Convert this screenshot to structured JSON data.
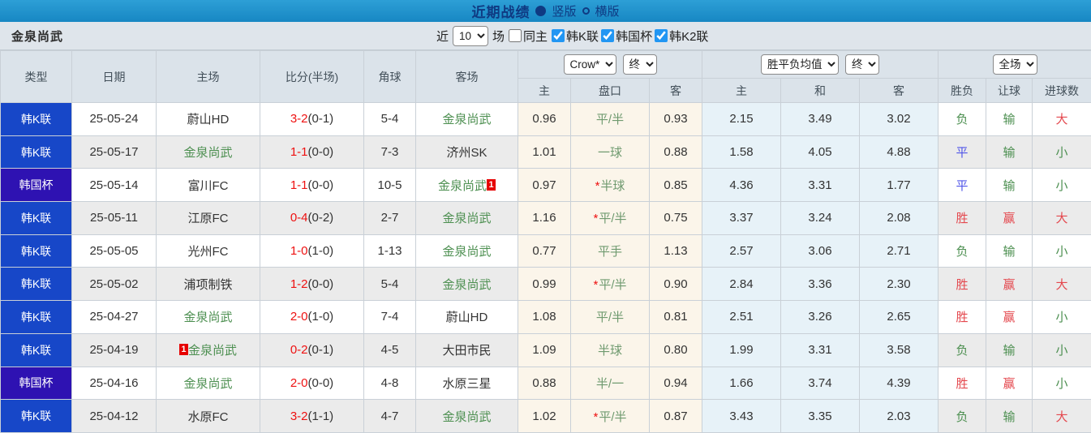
{
  "title_bar": {
    "title": "近期战绩",
    "radio_vertical": "竖版",
    "radio_horizontal": "横版",
    "vertical_selected": true
  },
  "filter_bar": {
    "team_name": "金泉尚武",
    "near_label": "近",
    "match_count": "10",
    "games_label": "场",
    "same_home_label": "同主",
    "same_home_checked": false,
    "league_filters": [
      {
        "label": "韩K联",
        "checked": true
      },
      {
        "label": "韩国杯",
        "checked": true
      },
      {
        "label": "韩K2联",
        "checked": true
      }
    ]
  },
  "table": {
    "cup_label": "韩国杯",
    "headers": {
      "type": "类型",
      "date": "日期",
      "home": "主场",
      "score": "比分(半场)",
      "corner": "角球",
      "away": "客场"
    },
    "odds_group": {
      "bookmaker": "Crow*",
      "period": "终",
      "sub": [
        "主",
        "盘口",
        "客"
      ]
    },
    "mean_group": {
      "label": "胜平负均值",
      "period": "终",
      "sub": [
        "主",
        "和",
        "客"
      ]
    },
    "result_group": {
      "label": "全场",
      "sub": [
        "胜负",
        "让球",
        "进球数"
      ]
    },
    "rows": [
      {
        "type": "韩K联",
        "date": "25-05-24",
        "home": "蔚山HD",
        "home_badge": null,
        "score": "3-2",
        "half": "(0-1)",
        "corner": "5-4",
        "away": "金泉尚武",
        "away_badge": null,
        "odds_home": "0.96",
        "handicap": "平/半",
        "handicap_star": false,
        "odds_away": "0.93",
        "avg_home": "2.15",
        "avg_draw": "3.49",
        "avg_away": "3.02",
        "result_wdl": "负",
        "result_handicap": "输",
        "result_goals": "大"
      },
      {
        "type": "韩K联",
        "date": "25-05-17",
        "home": "金泉尚武",
        "home_badge": null,
        "score": "1-1",
        "half": "(0-0)",
        "corner": "7-3",
        "away": "济州SK",
        "away_badge": null,
        "odds_home": "1.01",
        "handicap": "一球",
        "handicap_star": false,
        "odds_away": "0.88",
        "avg_home": "1.58",
        "avg_draw": "4.05",
        "avg_away": "4.88",
        "result_wdl": "平",
        "result_handicap": "输",
        "result_goals": "小"
      },
      {
        "type": "韩国杯",
        "date": "25-05-14",
        "home": "富川FC",
        "home_badge": null,
        "score": "1-1",
        "half": "(0-0)",
        "corner": "10-5",
        "away": "金泉尚武",
        "away_badge": {
          "text": "1",
          "pos": "after"
        },
        "odds_home": "0.97",
        "handicap": "半球",
        "handicap_star": true,
        "odds_away": "0.85",
        "avg_home": "4.36",
        "avg_draw": "3.31",
        "avg_away": "1.77",
        "result_wdl": "平",
        "result_handicap": "输",
        "result_goals": "小"
      },
      {
        "type": "韩K联",
        "date": "25-05-11",
        "home": "江原FC",
        "home_badge": null,
        "score": "0-4",
        "half": "(0-2)",
        "corner": "2-7",
        "away": "金泉尚武",
        "away_badge": null,
        "odds_home": "1.16",
        "handicap": "平/半",
        "handicap_star": true,
        "odds_away": "0.75",
        "avg_home": "3.37",
        "avg_draw": "3.24",
        "avg_away": "2.08",
        "result_wdl": "胜",
        "result_handicap": "赢",
        "result_goals": "大"
      },
      {
        "type": "韩K联",
        "date": "25-05-05",
        "home": "光州FC",
        "home_badge": null,
        "score": "1-0",
        "half": "(1-0)",
        "corner": "1-13",
        "away": "金泉尚武",
        "away_badge": null,
        "odds_home": "0.77",
        "handicap": "平手",
        "handicap_star": false,
        "odds_away": "1.13",
        "avg_home": "2.57",
        "avg_draw": "3.06",
        "avg_away": "2.71",
        "result_wdl": "负",
        "result_handicap": "输",
        "result_goals": "小"
      },
      {
        "type": "韩K联",
        "date": "25-05-02",
        "home": "浦项制铁",
        "home_badge": null,
        "score": "1-2",
        "half": "(0-0)",
        "corner": "5-4",
        "away": "金泉尚武",
        "away_badge": null,
        "odds_home": "0.99",
        "handicap": "平/半",
        "handicap_star": true,
        "odds_away": "0.90",
        "avg_home": "2.84",
        "avg_draw": "3.36",
        "avg_away": "2.30",
        "result_wdl": "胜",
        "result_handicap": "赢",
        "result_goals": "大"
      },
      {
        "type": "韩K联",
        "date": "25-04-27",
        "home": "金泉尚武",
        "home_badge": null,
        "score": "2-0",
        "half": "(1-0)",
        "corner": "7-4",
        "away": "蔚山HD",
        "away_badge": null,
        "odds_home": "1.08",
        "handicap": "平/半",
        "handicap_star": false,
        "odds_away": "0.81",
        "avg_home": "2.51",
        "avg_draw": "3.26",
        "avg_away": "2.65",
        "result_wdl": "胜",
        "result_handicap": "赢",
        "result_goals": "小"
      },
      {
        "type": "韩K联",
        "date": "25-04-19",
        "home": "金泉尚武",
        "home_badge": {
          "text": "1",
          "pos": "before"
        },
        "score": "0-2",
        "half": "(0-1)",
        "corner": "4-5",
        "away": "大田市民",
        "away_badge": null,
        "odds_home": "1.09",
        "handicap": "半球",
        "handicap_star": false,
        "odds_away": "0.80",
        "avg_home": "1.99",
        "avg_draw": "3.31",
        "avg_away": "3.58",
        "result_wdl": "负",
        "result_handicap": "输",
        "result_goals": "小"
      },
      {
        "type": "韩国杯",
        "date": "25-04-16",
        "home": "金泉尚武",
        "home_badge": null,
        "score": "2-0",
        "half": "(0-0)",
        "corner": "4-8",
        "away": "水原三星",
        "away_badge": null,
        "odds_home": "0.88",
        "handicap": "半/一",
        "handicap_star": false,
        "odds_away": "0.94",
        "avg_home": "1.66",
        "avg_draw": "3.74",
        "avg_away": "4.39",
        "result_wdl": "胜",
        "result_handicap": "赢",
        "result_goals": "小"
      },
      {
        "type": "韩K联",
        "date": "25-04-12",
        "home": "水原FC",
        "home_badge": null,
        "score": "3-2",
        "half": "(1-1)",
        "corner": "4-7",
        "away": "金泉尚武",
        "away_badge": null,
        "odds_home": "1.02",
        "handicap": "平/半",
        "handicap_star": true,
        "odds_away": "0.87",
        "avg_home": "3.43",
        "avg_draw": "3.35",
        "avg_away": "2.03",
        "result_wdl": "负",
        "result_handicap": "输",
        "result_goals": "大"
      }
    ]
  },
  "result_color_map": {
    "胜": "red",
    "平": "blue",
    "负": "green",
    "赢": "red",
    "输": "green",
    "大": "red",
    "小": "green"
  },
  "colors": {
    "topbar_blue_light": "#2d9fd6",
    "topbar_blue_dark": "#1787c3",
    "title_navy": "#0f3a82",
    "filterbar_bg": "#dfe5eb",
    "header_bg": "#dbe3ea",
    "header_text": "#43505a",
    "grid_border": "#c9d0d7",
    "league_blue": "#1747c8",
    "cup_indigo": "#2e12b2",
    "row_alt": "#ebebeb",
    "odds_bg": "#fbf5ea",
    "mean_bg": "#e7f2f8",
    "green": "#4c8f50",
    "handicap_green": "#6f9a6f",
    "red": "#e4484e",
    "score_red": "#ee1111",
    "draw_blue": "#5055e8",
    "badge_red": "#e60000",
    "checkbox_blue": "#2196f3",
    "text_dark": "#333333"
  }
}
